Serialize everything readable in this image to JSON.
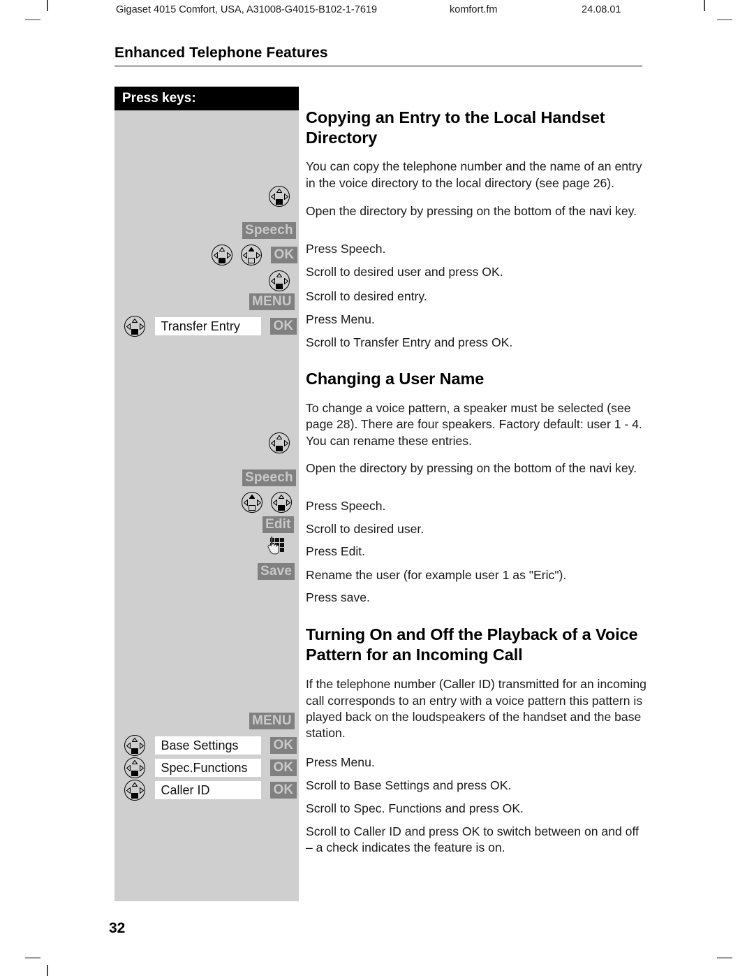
{
  "running_head": {
    "document": "Gigaset 4015 Comfort, USA, A31008-G4015-B102-1-7619",
    "file": "komfort.fm",
    "date": "24.08.01"
  },
  "chapter_title": "Enhanced Telephone Features",
  "key_column": {
    "header": "Press keys:"
  },
  "sections": [
    {
      "id": "copying-entry",
      "heading": "Copying an Entry to the Local Handset Directory",
      "intro": "You can copy the telephone number and the name of an entry in the voice directory to the local directory (see page 26).",
      "steps": [
        {
          "icon": "navi-key-down",
          "text": "Open the directory by pressing on the bottom of the navi key."
        },
        {
          "icon": "softkey-speech",
          "label": "Speech",
          "text": "Press Speech."
        },
        {
          "icon": "navi-scroll-ok",
          "label": "OK",
          "text": "Scroll to desired user and press OK."
        },
        {
          "icon": "navi-key-down",
          "text": "Scroll to desired entry."
        },
        {
          "icon": "softkey-menu",
          "label": "MENU",
          "text": "Press Menu."
        },
        {
          "icon": "navi-menu-ok",
          "field": "Transfer Entry",
          "label": "OK",
          "text": "Scroll to Transfer Entry and press OK."
        }
      ]
    },
    {
      "id": "changing-user-name",
      "heading": "Changing a User Name",
      "intro": "To change a voice pattern, a speaker must be selected (see page 28). There are four speakers. Factory default: user 1 - 4. You can rename these entries.",
      "steps": [
        {
          "icon": "navi-key-down",
          "text": "Open the directory by pressing on the bottom of the navi key."
        },
        {
          "icon": "softkey-speech",
          "label": "Speech",
          "text": "Press Speech."
        },
        {
          "icon": "navi-scroll-pair",
          "text": "Scroll to desired user."
        },
        {
          "icon": "softkey-edit",
          "label": "Edit",
          "text": "Press Edit."
        },
        {
          "icon": "keypad-hand",
          "text": "Rename the user (for example user 1 as  \"Eric\")."
        },
        {
          "icon": "softkey-save",
          "label": "Save",
          "text": "Press save."
        }
      ]
    },
    {
      "id": "voice-pattern-playback",
      "heading": "Turning On and Off the Playback of a Voice Pattern for an Incoming Call",
      "intro": "If the telephone number (Caller ID) transmitted for an incoming call corresponds to an entry with a voice pattern this pattern is played back on the loudspeakers of the handset and the base station.",
      "steps": [
        {
          "icon": "softkey-menu",
          "label": "MENU",
          "text": "Press Menu."
        },
        {
          "icon": "navi-menu-ok",
          "field": "Base Settings",
          "label": "OK",
          "text": "Scroll to Base Settings and press OK."
        },
        {
          "icon": "navi-menu-ok",
          "field": "Spec.Functions",
          "label": "OK",
          "text": "Scroll to Spec. Functions and press OK."
        },
        {
          "icon": "navi-menu-ok",
          "field": "Caller ID",
          "label": "OK",
          "text": "Scroll to Caller ID and press OK to switch between on and off – a check indicates the feature is on."
        }
      ]
    }
  ],
  "page_number": "32",
  "colors": {
    "key_panel_bg": "#cfcfcf",
    "key_header_bg": "#000000",
    "softkey_bg": "#808080",
    "softkey_text": "#c9c9c9",
    "menu_field_bg": "#ffffff"
  }
}
